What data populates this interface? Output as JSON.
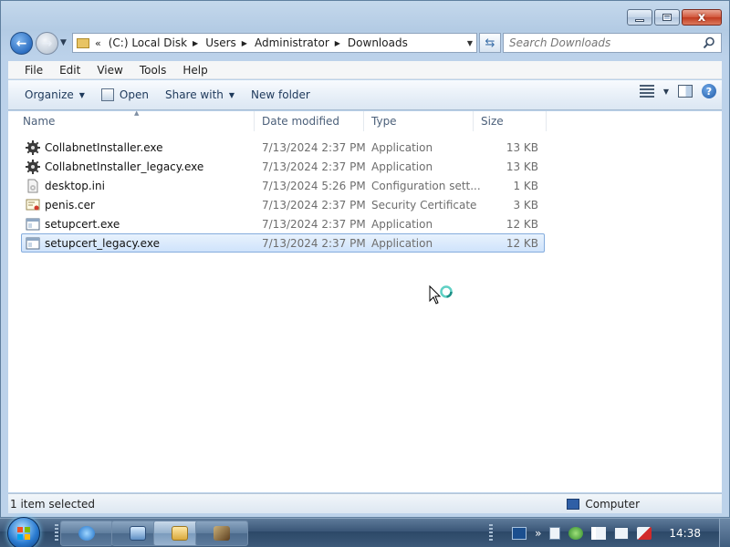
{
  "window": {
    "caption_close_glyph": "x"
  },
  "address": {
    "chevron": "«",
    "crumbs": [
      "(C:) Local Disk",
      "Users",
      "Administrator",
      "Downloads"
    ]
  },
  "search": {
    "placeholder": "Search Downloads"
  },
  "menu": [
    "File",
    "Edit",
    "View",
    "Tools",
    "Help"
  ],
  "toolbar": {
    "organize": "Organize",
    "open": "Open",
    "share_with": "Share with",
    "new_folder": "New folder",
    "help_glyph": "?"
  },
  "columns": {
    "name": "Name",
    "date": "Date modified",
    "type": "Type",
    "size": "Size"
  },
  "files": [
    {
      "name": "CollabnetInstaller.exe",
      "date": "7/13/2024 2:37 PM",
      "type": "Application",
      "size": "13 KB",
      "icon": "exe-gear-icon"
    },
    {
      "name": "CollabnetInstaller_legacy.exe",
      "date": "7/13/2024 2:37 PM",
      "type": "Application",
      "size": "13 KB",
      "icon": "exe-gear-icon"
    },
    {
      "name": "desktop.ini",
      "date": "7/13/2024 5:26 PM",
      "type": "Configuration sett...",
      "size": "1 KB",
      "icon": "ini-file-icon"
    },
    {
      "name": "penis.cer",
      "date": "7/13/2024 2:37 PM",
      "type": "Security Certificate",
      "size": "3 KB",
      "icon": "certificate-icon"
    },
    {
      "name": "setupcert.exe",
      "date": "7/13/2024 2:37 PM",
      "type": "Application",
      "size": "12 KB",
      "icon": "exe-window-icon"
    },
    {
      "name": "setupcert_legacy.exe",
      "date": "7/13/2024 2:37 PM",
      "type": "Application",
      "size": "12 KB",
      "icon": "exe-window-icon",
      "selected": true
    }
  ],
  "status": {
    "selection": "1 item selected",
    "location": "Computer"
  },
  "taskbar": {
    "clock": "14:38",
    "tray_chevron": "»"
  },
  "colors": {
    "selection_fill": "#cfe3fb",
    "selection_border": "#84acdd",
    "taskbar": "#3a5677"
  }
}
